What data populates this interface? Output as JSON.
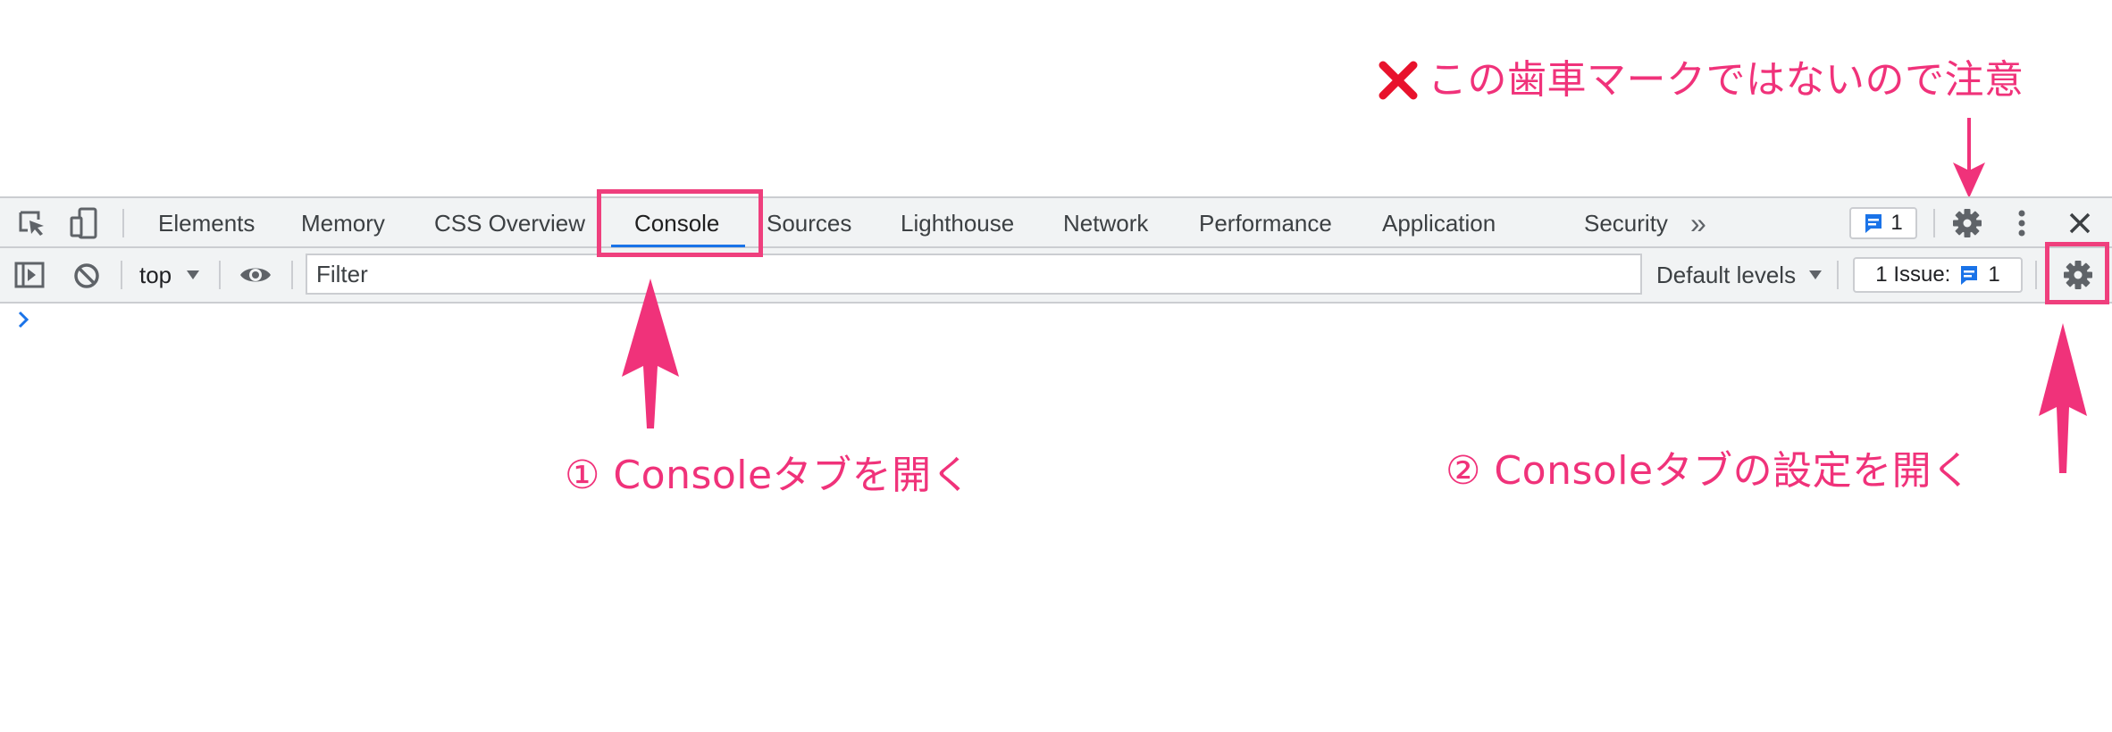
{
  "annotations": {
    "warning": "この歯車マークではないので注意",
    "step1": "① Consoleタブを開く",
    "step2": "② Consoleタブの設定を開く",
    "color": "#f0327a"
  },
  "tabbar": {
    "tabs": [
      "Elements",
      "Memory",
      "CSS Overview",
      "Console",
      "Sources",
      "Lighthouse",
      "Network",
      "Performance",
      "Application",
      "Security"
    ],
    "active_tab": "Console",
    "more_glyph": "»",
    "message_count": "1",
    "icons": [
      "inspect-element-icon",
      "device-toolbar-icon",
      "more-tabs-icon",
      "message-icon",
      "gear-icon",
      "kebab-menu-icon",
      "close-icon"
    ]
  },
  "console_toolbar": {
    "context": "top",
    "filter_placeholder": "Filter",
    "levels": "Default levels",
    "issues_label": "1 Issue:",
    "issues_count": "1",
    "icons": [
      "sidebar-toggle-icon",
      "clear-console-icon",
      "caret-down-icon",
      "eye-icon",
      "gear-icon"
    ]
  },
  "console": {
    "prompt_glyph": "›"
  },
  "colors": {
    "toolbar_bg": "#f1f3f4",
    "accent_blue": "#1a73e8",
    "highlight": "#ef3f7d"
  }
}
